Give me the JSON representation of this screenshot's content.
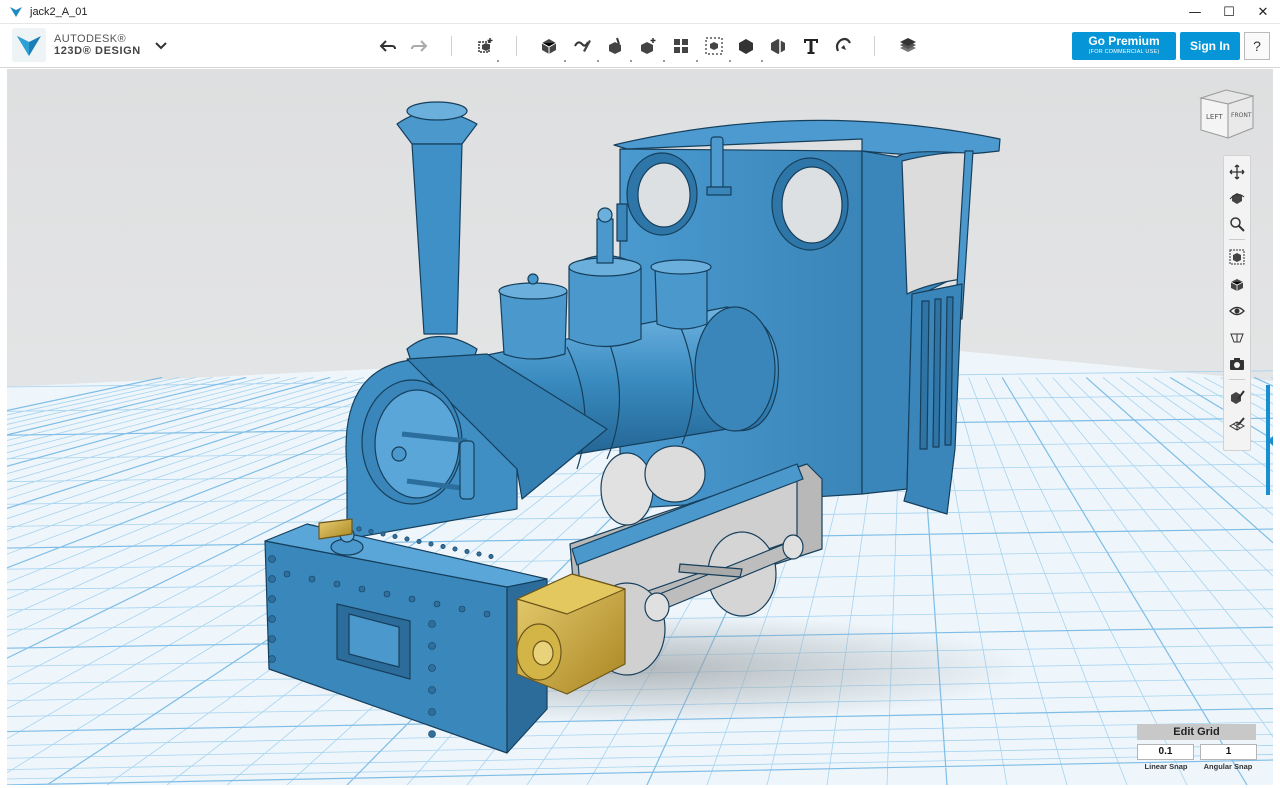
{
  "window": {
    "title": "jack2_A_01",
    "controls": {
      "minimize": "—",
      "maximize": "☐",
      "close": "✕"
    }
  },
  "logo": {
    "line1": "AUTODESK®",
    "line2": "123D® DESIGN",
    "icon": "123d-logo-icon"
  },
  "toolbar": {
    "undo_icon": "undo-icon",
    "redo_icon": "redo-icon",
    "tools": [
      "transform-icon",
      "primitives-icon",
      "sketch-icon",
      "construct-icon",
      "modify-icon",
      "pattern-icon",
      "group-icon",
      "combine-icon",
      "measure-icon",
      "text-icon",
      "snap-icon",
      "material-icon"
    ]
  },
  "account": {
    "premium_label": "Go Premium",
    "premium_sub": "(FOR COMMERCIAL USE)",
    "signin_label": "Sign In",
    "help_label": "?"
  },
  "viewcube": {
    "left_face": "LEFT",
    "front_face": "FRONT"
  },
  "navbar": {
    "items": [
      "pan-icon",
      "orbit-icon",
      "zoom-icon",
      "fit-icon",
      "view-icon",
      "visibility-icon",
      "materials-outline-icon",
      "camera-icon",
      "sketch-toggle-icon",
      "grid-toggle-icon"
    ]
  },
  "grid_panel": {
    "header": "Edit Grid",
    "linear_snap_value": "0.1",
    "angular_snap_value": "1",
    "linear_snap_label": "Linear Snap",
    "angular_snap_label": "Angular Snap"
  },
  "colors": {
    "model_blue": "#3d8fc2",
    "accent": "#0696d7",
    "brass": "#c9a83a",
    "grid_line": "#9fd0f0",
    "background": "#e2e4e5"
  }
}
